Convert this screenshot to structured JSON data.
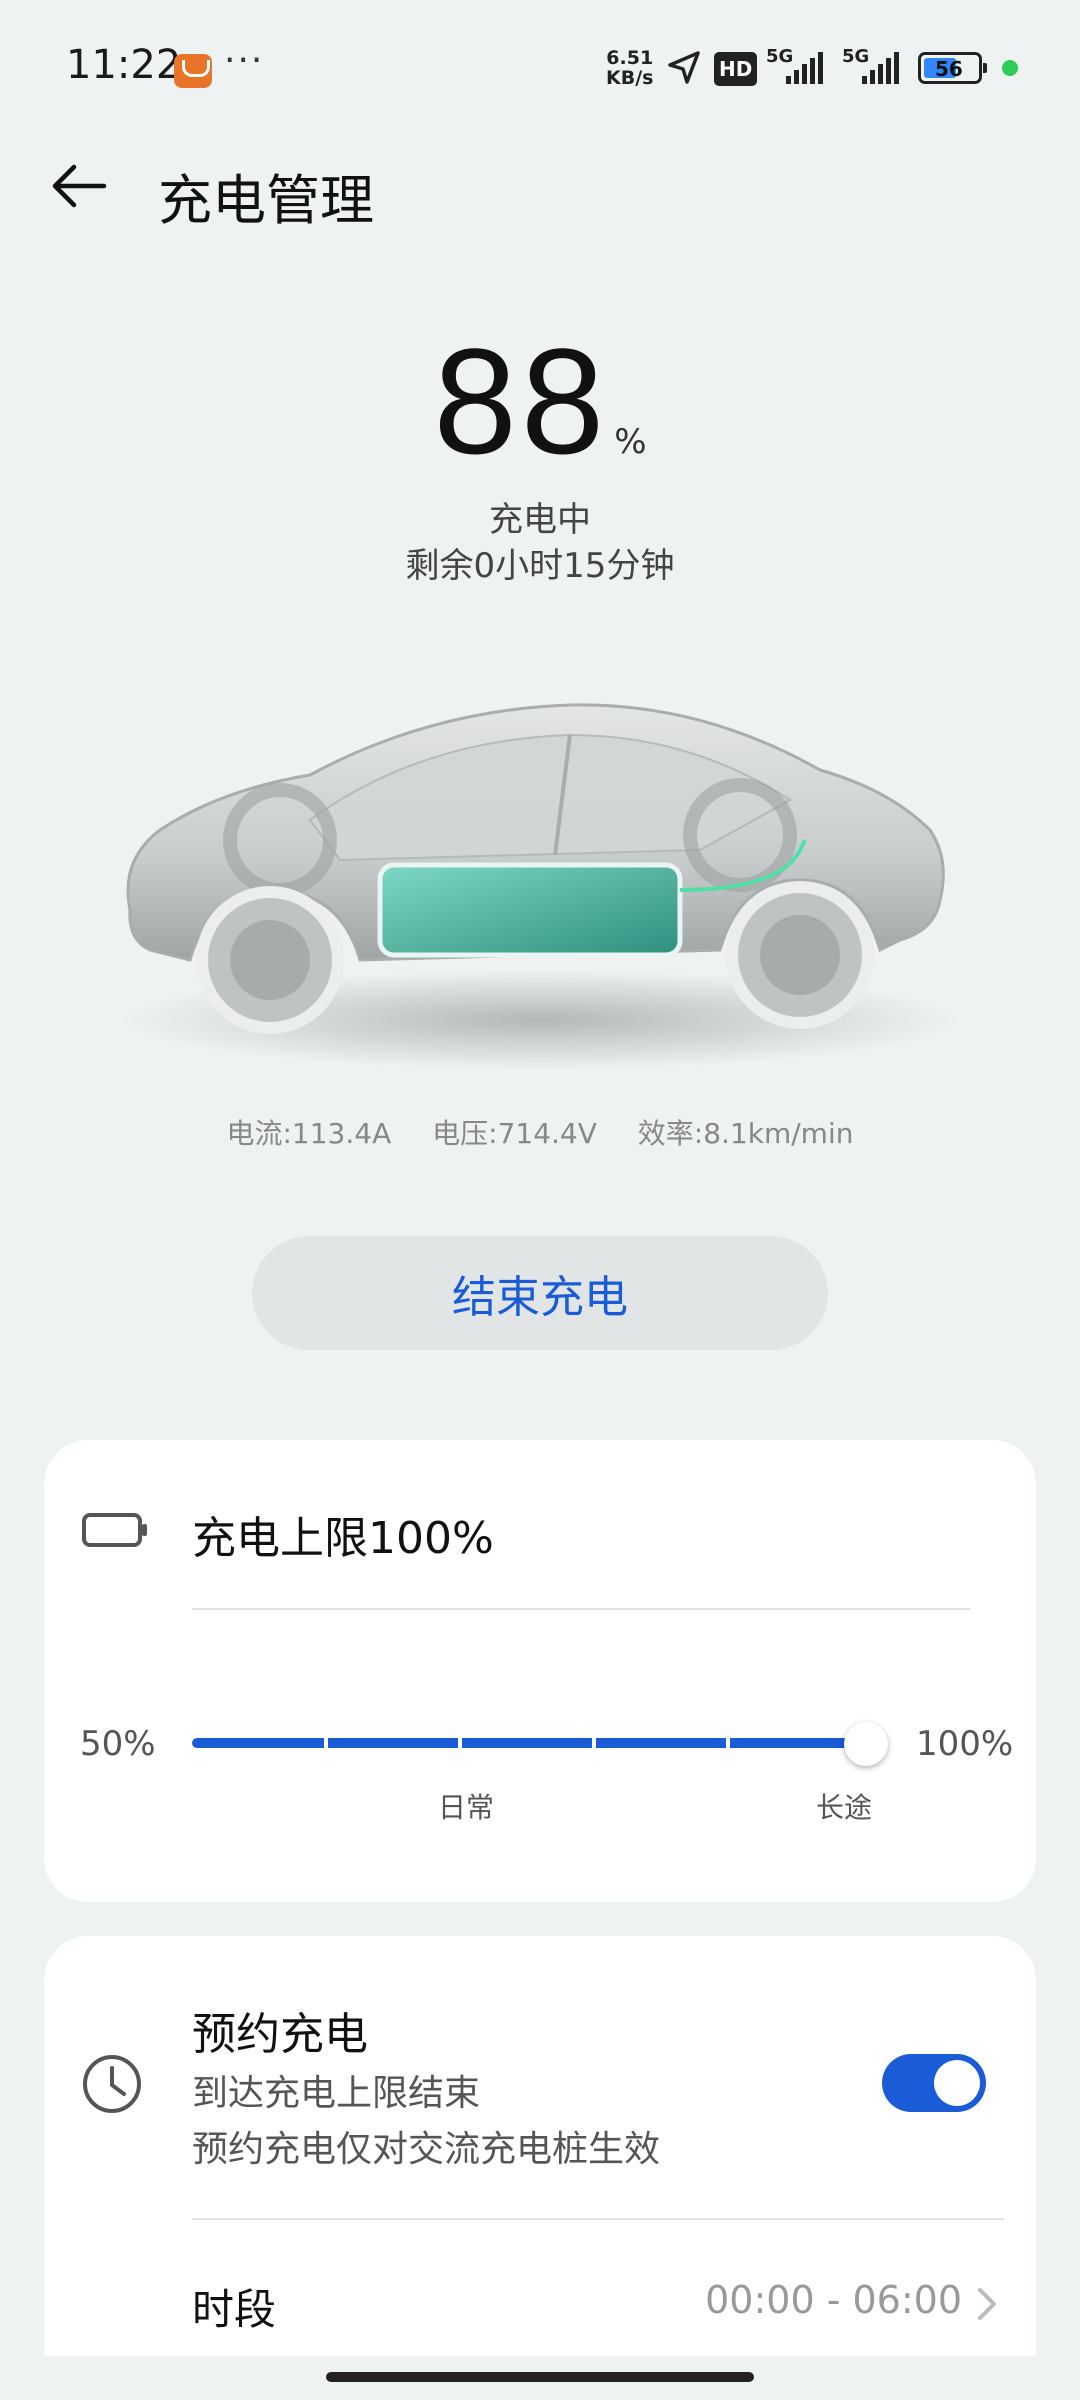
{
  "status_bar": {
    "time": "11:22",
    "more": "···",
    "speed_value": "6.51",
    "speed_unit": "KB/s",
    "hd": "HD",
    "signal1": "5G",
    "signal2": "5G",
    "battery_level": "56"
  },
  "header": {
    "title": "充电管理"
  },
  "charge": {
    "percent": "88",
    "unit": "%",
    "status": "充电中",
    "remaining": "剩余0小时15分钟"
  },
  "stats": {
    "current": "电流:113.4A",
    "voltage": "电压:714.4V",
    "efficiency": "效率:8.1km/min"
  },
  "end_button": "结束充电",
  "charge_limit": {
    "title": "充电上限100%",
    "min_label": "50%",
    "max_label": "100%",
    "daily": "日常",
    "longtrip": "长途",
    "value_percent": 100
  },
  "schedule": {
    "title": "预约充电",
    "subtitle1": "到达充电上限结束",
    "subtitle2": "预约充电仅对交流充电桩生效",
    "enabled": true,
    "period_label": "时段",
    "period_value": "00:00 - 06:00"
  },
  "colors": {
    "accent": "#1a5bd8",
    "background": "#eef2f2",
    "status_dot": "#2ecc57"
  }
}
